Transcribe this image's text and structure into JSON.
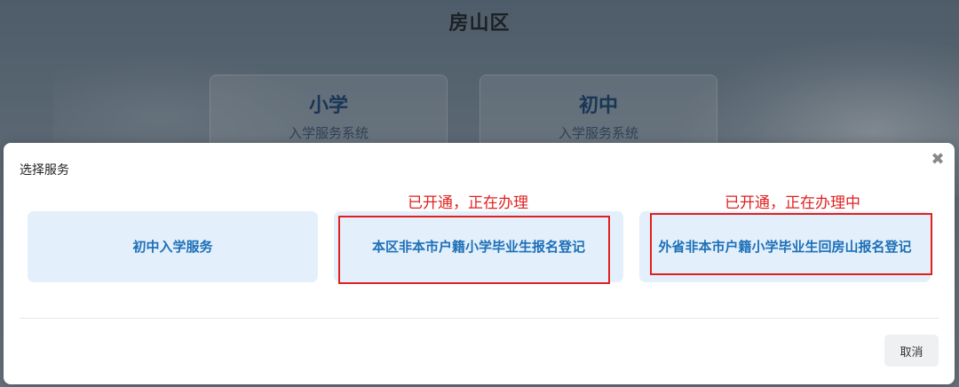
{
  "background": {
    "district_title": "房山区",
    "cards": [
      {
        "name": "小学",
        "subtitle": "入学服务系统"
      },
      {
        "name": "初中",
        "subtitle": "入学服务系统"
      }
    ]
  },
  "modal": {
    "title": "选择服务",
    "close_icon": "close-icon",
    "services": [
      {
        "label": "初中入学服务"
      },
      {
        "label": "本区非本市户籍小学毕业生报名登记"
      },
      {
        "label": "外省非本市户籍小学毕业生回房山报名登记"
      }
    ],
    "cancel_label": "取消"
  },
  "annotations": [
    {
      "text": "已开通，正在办理"
    },
    {
      "text": "已开通，正在办理中"
    }
  ],
  "colors": {
    "accent": "#1d6fb8",
    "service_bg": "#e3f0fb",
    "annotation_red": "#e21f1f"
  }
}
